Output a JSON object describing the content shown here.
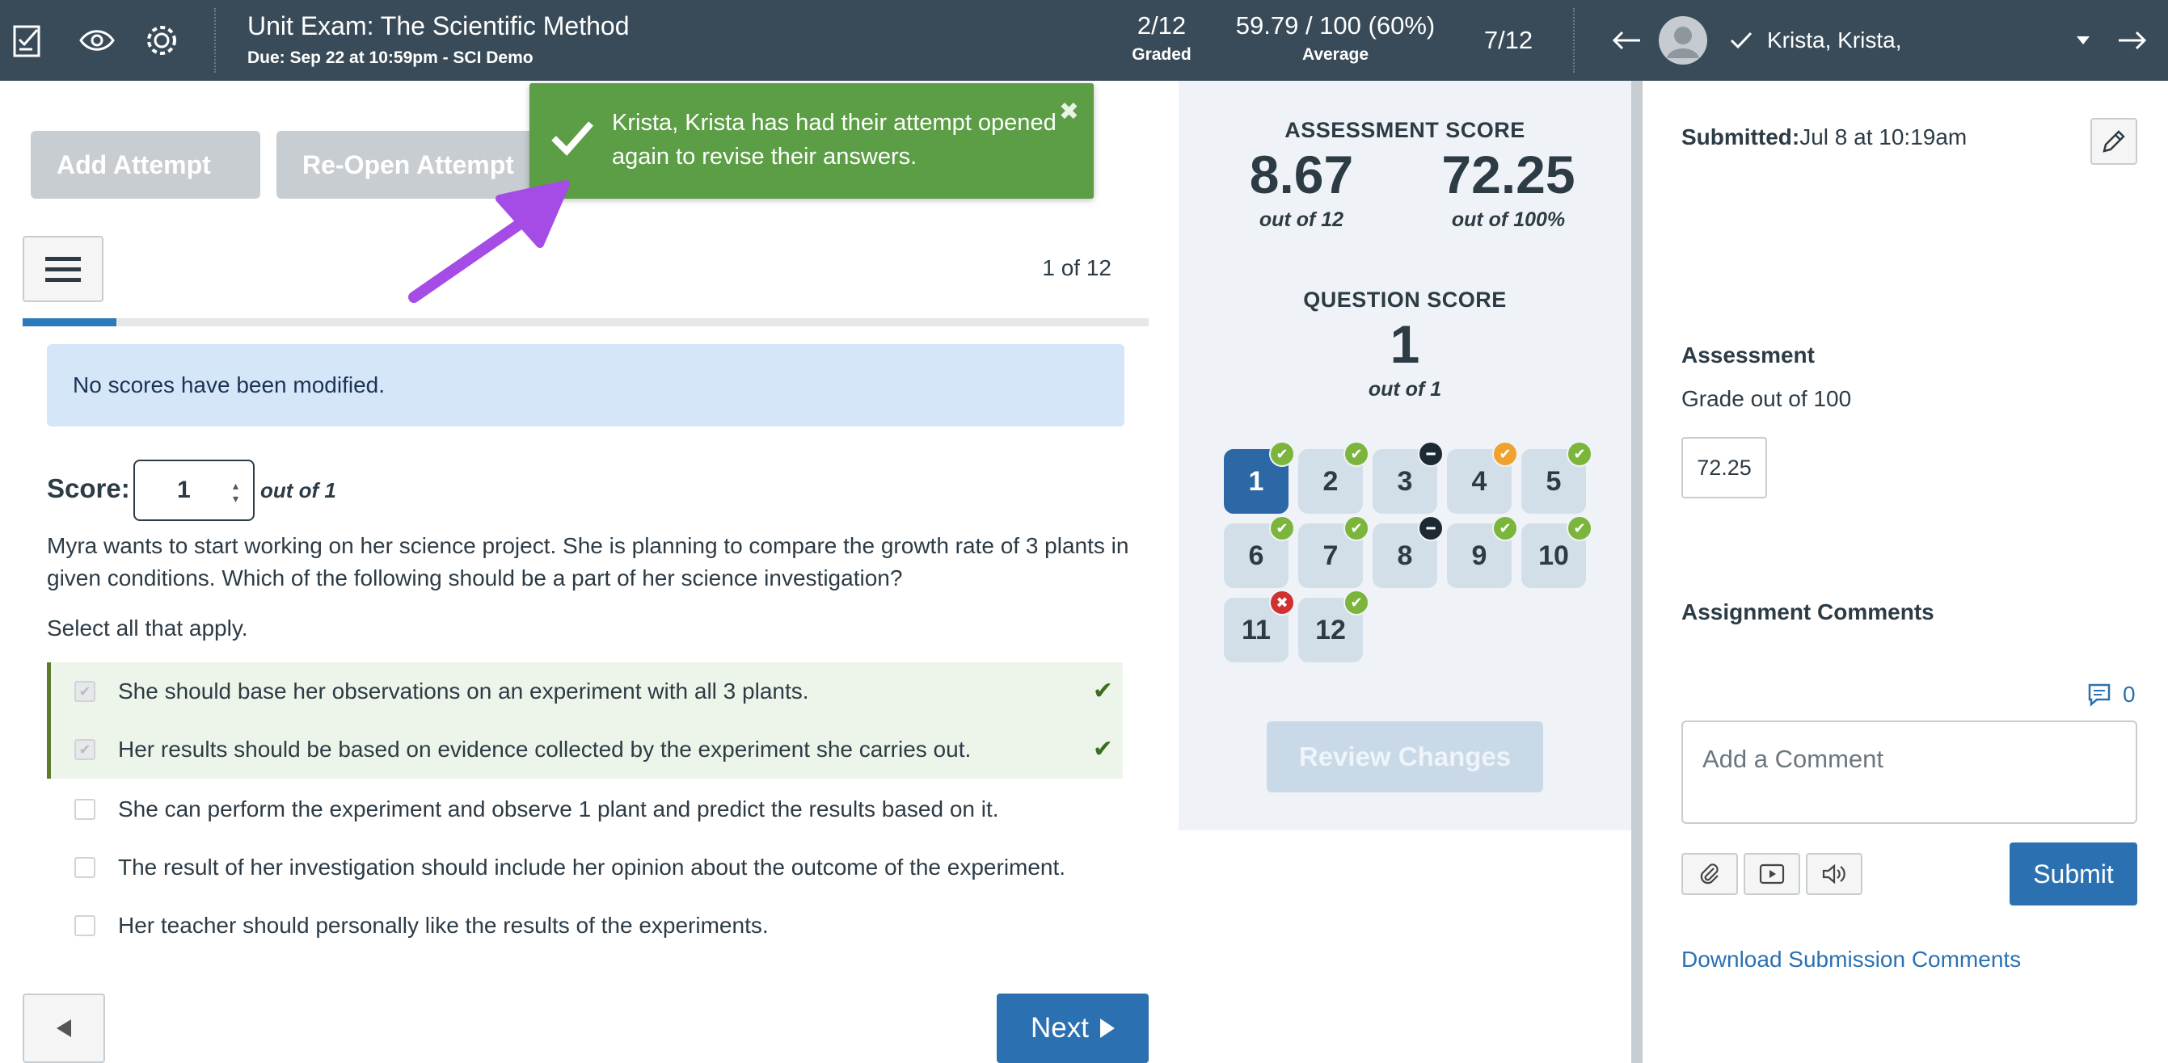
{
  "header": {
    "assignment_title": "Unit Exam: The Scientific Method",
    "due_text": "Due: Sep 22 at 10:59pm - SCI Demo",
    "graded_count": "2/12",
    "graded_label": "Graded",
    "average_value": "59.79 / 100 (60%)",
    "average_label": "Average",
    "student_position": "7/12",
    "student_name": "Krista, Krista,"
  },
  "toolbar": {
    "add_attempt": "Add Attempt",
    "reopen_attempt": "Re-Open Attempt"
  },
  "toast": {
    "message": "Krista, Krista has had their attempt opened again to revise their answers.",
    "close_glyph": "✖"
  },
  "question": {
    "counter": "1 of 12",
    "progress_fraction": 0.083,
    "notice": "No scores have been modified.",
    "score_label": "Score:",
    "score_value": "1",
    "score_out_of": "out of 1",
    "text": "Myra wants to start working on her science project. She is planning to compare the growth rate of 3 plants in given conditions. Which of the following should be a part of her science investigation?",
    "instruction": "Select all that apply.",
    "answers": [
      {
        "text": "She should base her observations on an experiment with all 3 plants.",
        "selected": true,
        "correct": true
      },
      {
        "text": "Her results should be based on evidence collected by the experiment she carries out.",
        "selected": true,
        "correct": true
      },
      {
        "text": "She can perform the experiment and observe 1 plant and predict the results based on it.",
        "selected": false,
        "correct": false
      },
      {
        "text": "The result of her investigation should include her opinion about the outcome of the experiment.",
        "selected": false,
        "correct": false
      },
      {
        "text": "Her teacher should personally like the results of the experiments.",
        "selected": false,
        "correct": false
      }
    ]
  },
  "nav": {
    "next_label": "Next",
    "prev_icon": "left-triangle",
    "next_icon": "right-triangle"
  },
  "assessment": {
    "heading": "ASSESSMENT SCORE",
    "points": "8.67",
    "points_sub": "out of 12",
    "percent": "72.25",
    "percent_sub": "out of 100%",
    "question_heading": "QUESTION SCORE",
    "question_score": "1",
    "question_sub": "out of 1",
    "questions": [
      {
        "number": "1",
        "status": "correct",
        "active": true
      },
      {
        "number": "2",
        "status": "correct",
        "active": false
      },
      {
        "number": "3",
        "status": "blank",
        "active": false
      },
      {
        "number": "4",
        "status": "partial",
        "active": false
      },
      {
        "number": "5",
        "status": "correct",
        "active": false
      },
      {
        "number": "6",
        "status": "correct",
        "active": false
      },
      {
        "number": "7",
        "status": "correct",
        "active": false
      },
      {
        "number": "8",
        "status": "blank",
        "active": false
      },
      {
        "number": "9",
        "status": "correct",
        "active": false
      },
      {
        "number": "10",
        "status": "correct",
        "active": false
      },
      {
        "number": "11",
        "status": "wrong",
        "active": false
      },
      {
        "number": "12",
        "status": "correct",
        "active": false
      }
    ],
    "review_changes": "Review Changes"
  },
  "sidebar": {
    "submitted_label": "Submitted:",
    "submitted_date": "Jul 8 at 10:19am",
    "assessment_heading": "Assessment",
    "grade_label": "Grade out of 100",
    "grade_value": "72.25",
    "comments_heading": "Assignment Comments",
    "comment_count": "0",
    "comment_placeholder": "Add a Comment",
    "submit_label": "Submit",
    "download_link": "Download Submission Comments"
  },
  "colors": {
    "topbar": "#394b58",
    "primary": "#2b71b1",
    "toast": "#5c9e45",
    "annotation_arrow": "#a64ce6",
    "correct_badge": "#7bb53c",
    "partial_badge": "#f0a22c",
    "wrong_badge": "#d0302e"
  }
}
